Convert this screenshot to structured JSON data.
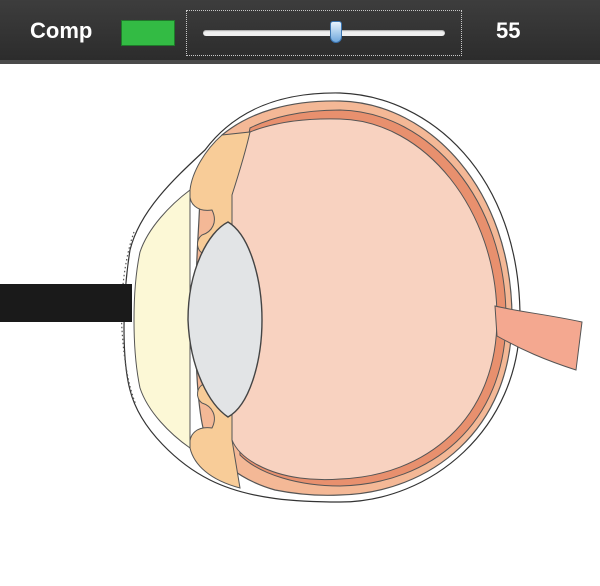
{
  "toolbar": {
    "label": "Comp",
    "swatch_color": "#33bb44",
    "slider": {
      "min": 0,
      "max": 100,
      "value": 55
    },
    "value_text": "55"
  },
  "diagram": {
    "subject": "eye-cross-section",
    "colors": {
      "sclera": "#f4b896",
      "choroid": "#e8906e",
      "vitreous": "#f8d2c0",
      "ciliary": "#f8cc98",
      "cornea": "#fcf8d6",
      "lens": "#e2e4e6",
      "optic_nerve": "#f4a890",
      "object_bar": "#1a1a1a"
    }
  }
}
